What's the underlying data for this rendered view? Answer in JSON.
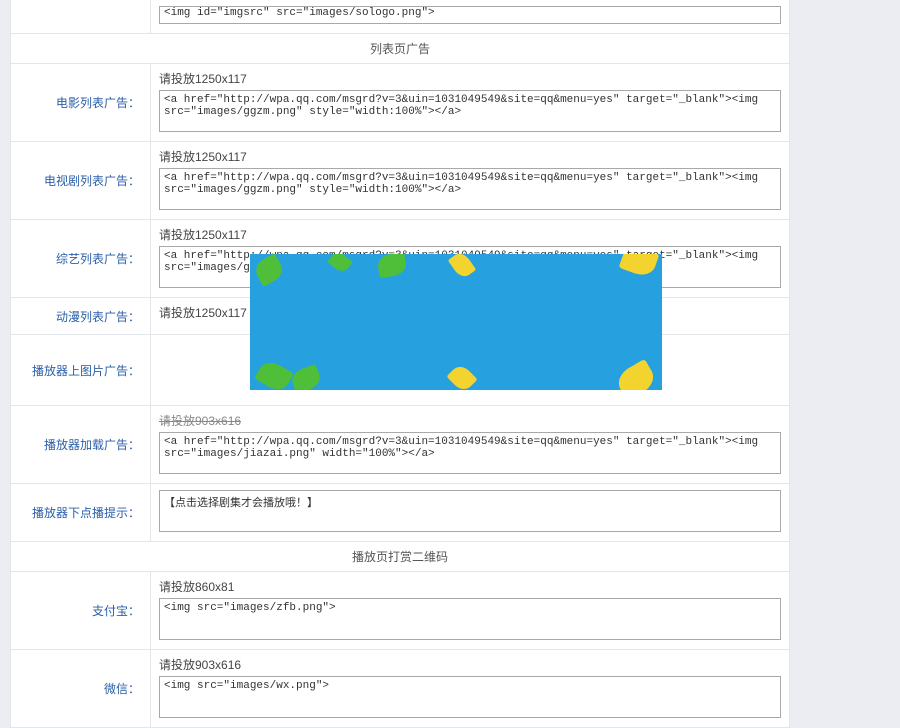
{
  "top_textarea_value": "<img id=\"imgsrc\" src=\"images/sologo.png\">",
  "section1_title": "列表页广告",
  "rows": {
    "movie": {
      "label": "电影列表广告：",
      "hint": "请投放1250x117",
      "value": "<a href=\"http://wpa.qq.com/msgrd?v=3&uin=1031049549&site=qq&menu=yes\" target=\"_blank\"><img src=\"images/ggzm.png\" style=\"width:100%\"></a>"
    },
    "tv": {
      "label": "电视剧列表广告：",
      "hint": "请投放1250x117",
      "value": "<a href=\"http://wpa.qq.com/msgrd?v=3&uin=1031049549&site=qq&menu=yes\" target=\"_blank\"><img src=\"images/ggzm.png\" style=\"width:100%\"></a>"
    },
    "variety": {
      "label": "综艺列表广告：",
      "hint": "请投放1250x117",
      "value": "<a href=\"http://wpa.qq.com/msgrd?v=3&uin=1031049549&site=qq&menu=yes\" target=\"_blank\"><img src=\"images/ggzm.png\" style=\"width:100%\"></a>"
    },
    "anime": {
      "label": "动漫列表广告：",
      "hint": "请投放1250x117",
      "value": ""
    },
    "player_top": {
      "label": "播放器上图片广告：",
      "hint": "",
      "value": ""
    },
    "player_load": {
      "label": "播放器加载广告：",
      "hint": "请投放903x616",
      "value": "<a href=\"http://wpa.qq.com/msgrd?v=3&uin=1031049549&site=qq&menu=yes\" target=\"_blank\"><img src=\"images/jiazai.png\" width=\"100%\"></a>"
    },
    "player_tip": {
      "label": "播放器下点播提示：",
      "value": "【点击选择剧集才会播放哦！】"
    }
  },
  "section2_title": "播放页打赏二维码",
  "qr": {
    "alipay": {
      "label": "支付宝：",
      "hint": "请投放860x81",
      "value": "<img src=\"images/zfb.png\">"
    },
    "wechat": {
      "label": "微信：",
      "hint": "请投放903x616",
      "value": "<img src=\"images/wx.png\">"
    }
  }
}
